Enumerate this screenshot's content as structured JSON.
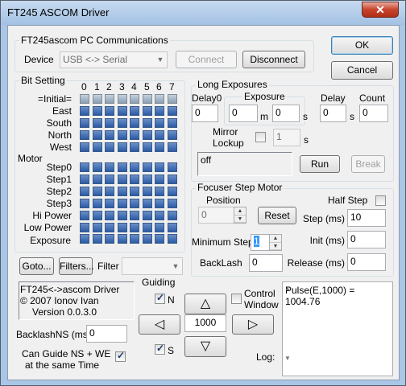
{
  "window": {
    "title": "FT245 ASCOM Driver",
    "close_glyph": "✕"
  },
  "buttons": {
    "ok": "OK",
    "cancel": "Cancel",
    "connect": "Connect",
    "disconnect": "Disconnect",
    "run": "Run",
    "break": "Break",
    "reset": "Reset",
    "goto": "Goto...",
    "filters": "Filters..."
  },
  "comms": {
    "title": "FT245ascom PC Communications",
    "device_label": "Device",
    "device_value": "USB <-> Serial"
  },
  "bits": {
    "title": "Bit Setting",
    "columns": [
      "0",
      "1",
      "2",
      "3",
      "4",
      "5",
      "6",
      "7"
    ],
    "rows": [
      "=Initial=",
      "East",
      "South",
      "North",
      "West",
      "Step0",
      "Step1",
      "Step2",
      "Step3",
      "Hi Power",
      "Low Power"
    ],
    "motor_label": "Motor",
    "exposure_label": "Exposure"
  },
  "filter": {
    "label": "Filter",
    "value": ""
  },
  "long_exp": {
    "title": "Long Exposures",
    "delay0_label": "Delay0",
    "delay0": "0",
    "exposure_label": "Exposure",
    "exp_m": "0",
    "unit_m": "m",
    "exp_s": "0",
    "unit_s": "s",
    "delay_label": "Delay",
    "delay": "0",
    "delay_unit": "s",
    "count_label": "Count",
    "count": "0",
    "mirror_label_1": "Mirror",
    "mirror_label_2": "Lockup",
    "mirror_value": "1",
    "mirror_unit": "s",
    "status": "off"
  },
  "focuser": {
    "title": "Focuser Step Motor",
    "position_label": "Position",
    "position": "0",
    "half_step_label": "Half Step",
    "step_ms_label": "Step (ms)",
    "step_ms": "10",
    "min_step_label": "Minimum Step",
    "min_step": "1",
    "init_ms_label": "Init (ms)",
    "init_ms": "0",
    "backlash_label": "BackLash",
    "backlash": "0",
    "release_label": "Release (ms)",
    "release": "0"
  },
  "about": {
    "line1": "FT245<->ascom Driver",
    "line2": "© 2007 Ionov Ivan",
    "line3": "Version 0.0.3.0"
  },
  "guiding": {
    "title": "Guiding",
    "n_label": "N",
    "s_label": "S",
    "up": "△",
    "down": "▽",
    "left": "◁",
    "right": "▷",
    "duration": "1000",
    "control_window_1": "Control",
    "control_window_2": "Window"
  },
  "log": {
    "text_1": "Pulse(E,1000) =",
    "text_2": "1004.76",
    "label": "Log:"
  },
  "backlash_ns": {
    "label": "BacklashNS (ms)",
    "value": "0"
  },
  "guide_both": {
    "label_1": "Can Guide NS + WE",
    "label_2": "at the same Time"
  }
}
